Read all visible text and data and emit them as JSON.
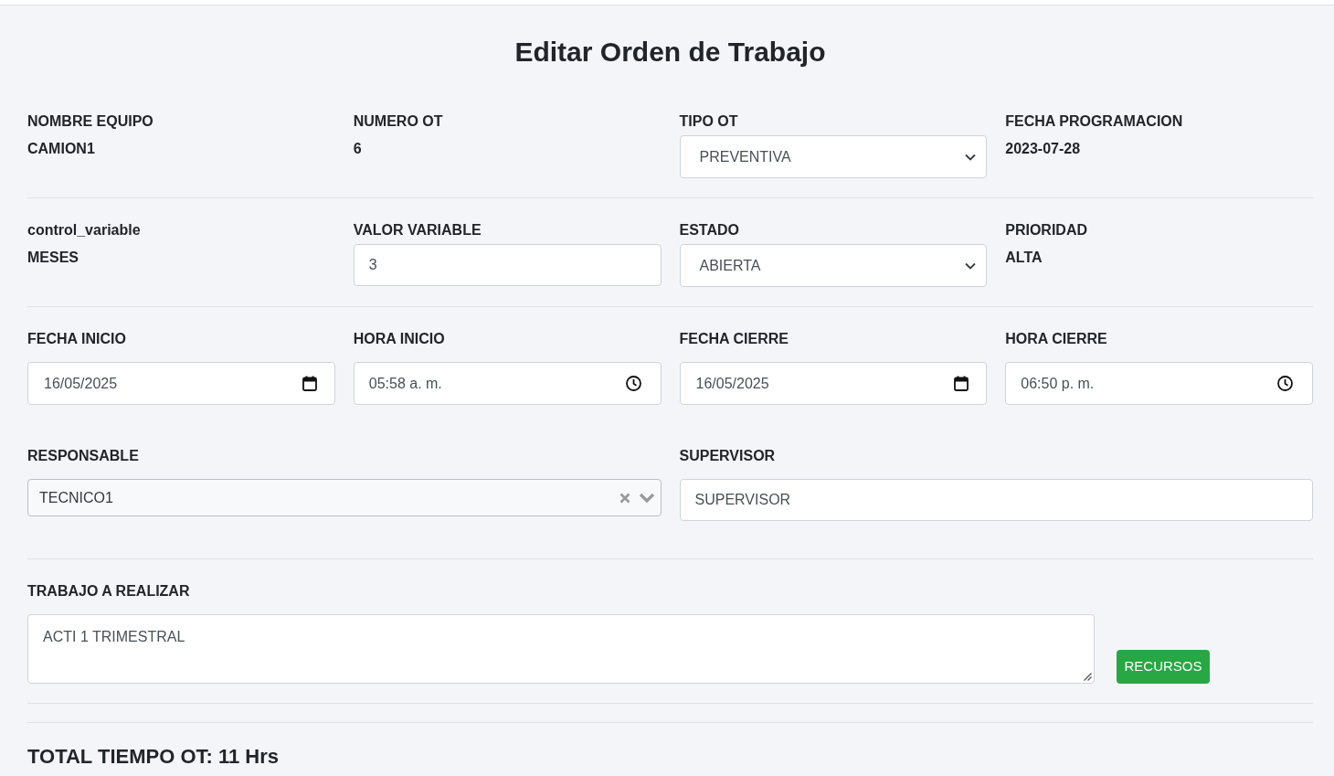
{
  "title": "Editar Orden de Trabajo",
  "rows": [
    {
      "fields": [
        {
          "kind": "display",
          "label": "NOMBRE EQUIPO",
          "value": "CAMION1"
        },
        {
          "kind": "display",
          "label": "NUMERO OT",
          "value": "6"
        },
        {
          "kind": "select",
          "label": "TIPO OT",
          "value": "PREVENTIVA"
        },
        {
          "kind": "display",
          "label": "FECHA PROGRAMACION",
          "value": "2023-07-28"
        }
      ]
    },
    {
      "fields": [
        {
          "kind": "display",
          "label": "control_variable",
          "value": "MESES"
        },
        {
          "kind": "input",
          "label": "VALOR VARIABLE",
          "value": "3"
        },
        {
          "kind": "select",
          "label": "ESTADO",
          "value": "ABIERTA"
        },
        {
          "kind": "display",
          "label": "PRIORIDAD",
          "value": "ALTA"
        }
      ]
    },
    {
      "fields": [
        {
          "kind": "date",
          "label": "FECHA INICIO",
          "value": "16/05/2025"
        },
        {
          "kind": "time",
          "label": "HORA INICIO",
          "value": "05:58 a. m."
        },
        {
          "kind": "date",
          "label": "FECHA CIERRE",
          "value": "16/05/2025"
        },
        {
          "kind": "time",
          "label": "HORA CIERRE",
          "value": "06:50 p. m."
        }
      ]
    },
    {
      "fields": [
        {
          "kind": "combobox",
          "label": "RESPONSABLE",
          "value": "TECNICO1"
        },
        {
          "kind": "input",
          "label": "SUPERVISOR",
          "value": "SUPERVISOR"
        }
      ]
    }
  ],
  "work": {
    "label": "TRABAJO A REALIZAR",
    "value": "ACTI 1 TRIMESTRAL"
  },
  "resources_button": "RECURSOS",
  "total": "TOTAL TIEMPO OT: 11 Hrs"
}
